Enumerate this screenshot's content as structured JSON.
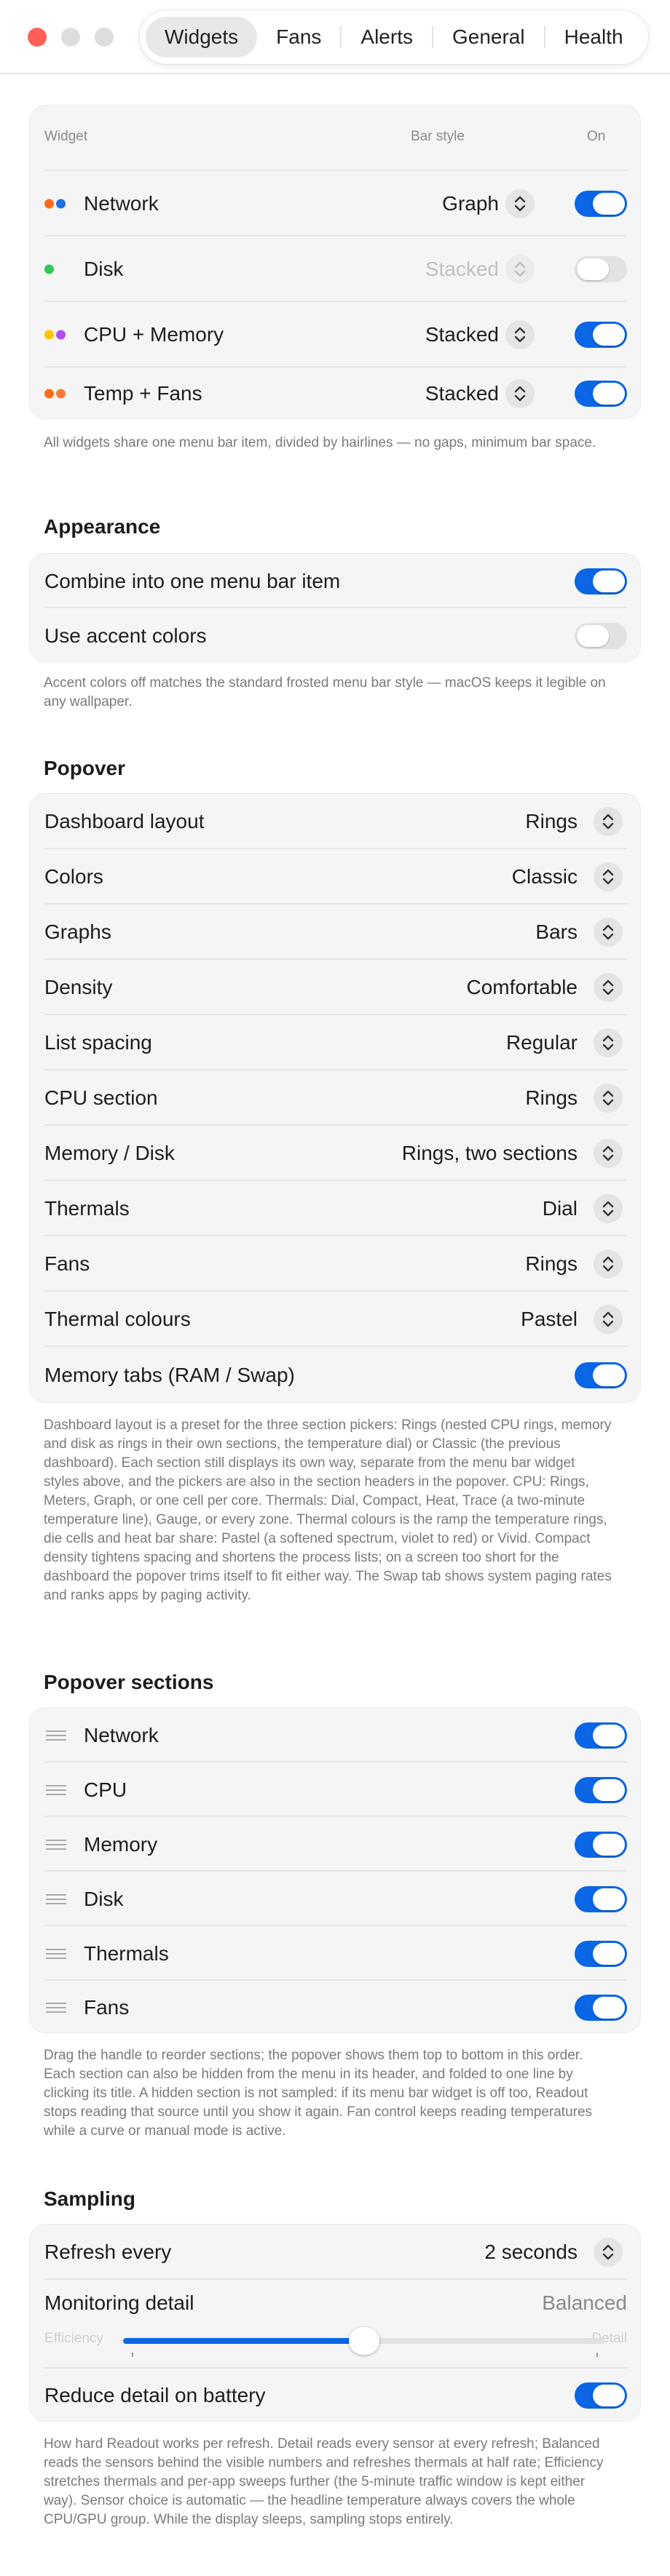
{
  "tabs": [
    {
      "label": "Widgets",
      "active": true
    },
    {
      "label": "Fans"
    },
    {
      "label": "Alerts"
    },
    {
      "label": "General"
    },
    {
      "label": "Health"
    }
  ],
  "widgets": {
    "header": {
      "widget": "Widget",
      "bar_style": "Bar style",
      "on": "On"
    },
    "rows": [
      {
        "name": "Network",
        "style": "Graph",
        "on": true,
        "dots": [
          "#ff6a1a",
          "#1f6fe5"
        ]
      },
      {
        "name": "Disk",
        "style": "Stacked",
        "on": false,
        "dimmed": true,
        "dots": [
          "#32c759"
        ]
      },
      {
        "name": "CPU + Memory",
        "style": "Stacked",
        "on": true,
        "dots": [
          "#ffc400",
          "#b44cf0"
        ]
      },
      {
        "name": "Temp + Fans",
        "style": "Stacked",
        "on": true,
        "dots": [
          "#ff6a1a",
          "#ff7a3a"
        ]
      }
    ],
    "footnote": "All widgets share one menu bar item, divided by hairlines — no gaps, minimum bar space."
  },
  "appearance": {
    "title": "Appearance",
    "rows": [
      {
        "label": "Combine into one menu bar item",
        "on": true
      },
      {
        "label": "Use accent colors",
        "on": false
      }
    ],
    "footnote": "Accent colors off matches the standard frosted menu bar style — macOS keeps it legible on any wallpaper."
  },
  "popover": {
    "title": "Popover",
    "rows": [
      {
        "label": "Dashboard layout",
        "value": "Rings"
      },
      {
        "label": "Colors",
        "value": "Classic"
      },
      {
        "label": "Graphs",
        "value": "Bars"
      },
      {
        "label": "Density",
        "value": "Comfortable"
      },
      {
        "label": "List spacing",
        "value": "Regular"
      },
      {
        "label": "CPU section",
        "value": "Rings"
      },
      {
        "label": "Memory / Disk",
        "value": "Rings, two sections"
      },
      {
        "label": "Thermals",
        "value": "Dial"
      },
      {
        "label": "Fans",
        "value": "Rings"
      },
      {
        "label": "Thermal colours",
        "value": "Pastel"
      }
    ],
    "toggle_row": {
      "label": "Memory tabs (RAM / Swap)",
      "on": true
    },
    "footnote": "Dashboard layout is a preset for the three section pickers: Rings (nested CPU rings, memory and disk as rings in their own sections, the temperature dial) or Classic (the previous dashboard). Each section still displays its own way, separate from the menu bar widget styles above, and the pickers are also in the section headers in the popover. CPU: Rings, Meters, Graph, or one cell per core. Thermals: Dial, Compact, Heat, Trace (a two-minute temperature line), Gauge, or every zone. Thermal colours is the ramp the temperature rings, die cells and heat bar share: Pastel (a softened spectrum, violet to red) or Vivid. Compact density tightens spacing and shortens the process lists; on a screen too short for the dashboard the popover trims itself to fit either way. The Swap tab shows system paging rates and ranks apps by paging activity."
  },
  "sections": {
    "title": "Popover sections",
    "rows": [
      {
        "label": "Network",
        "on": true
      },
      {
        "label": "CPU",
        "on": true
      },
      {
        "label": "Memory",
        "on": true
      },
      {
        "label": "Disk",
        "on": true
      },
      {
        "label": "Thermals",
        "on": true
      },
      {
        "label": "Fans",
        "on": true
      }
    ],
    "footnote": "Drag the handle to reorder sections; the popover shows them top to bottom in this order. Each section can also be hidden from the menu in its header, and folded to one line by clicking its title. A hidden section is not sampled: if its menu bar widget is off too, Readout stops reading that source until you show it again. Fan control keeps reading temperatures while a curve or manual mode is active."
  },
  "sampling": {
    "title": "Sampling",
    "refresh_label": "Refresh every",
    "refresh_value": "2 seconds",
    "detail_label": "Monitoring detail",
    "detail_value": "Balanced",
    "detail_min": "Efficiency",
    "detail_max": "Detail",
    "detail_position": 0.5,
    "battery_label": "Reduce detail on battery",
    "battery_on": true,
    "footnote": "How hard Readout works per refresh. Detail reads every sensor at every refresh; Balanced reads the sensors behind the visible numbers and refreshes thermals at half rate; Efficiency stretches thermals and per-app sweeps further (the 5-minute traffic window is kept either way). Sensor choice is automatic — the headline temperature always covers the whole CPU/GPU group. While the display sleeps, sampling stops entirely."
  },
  "colors": {
    "accent": "#0a66e4",
    "close": "#ff5f57"
  }
}
